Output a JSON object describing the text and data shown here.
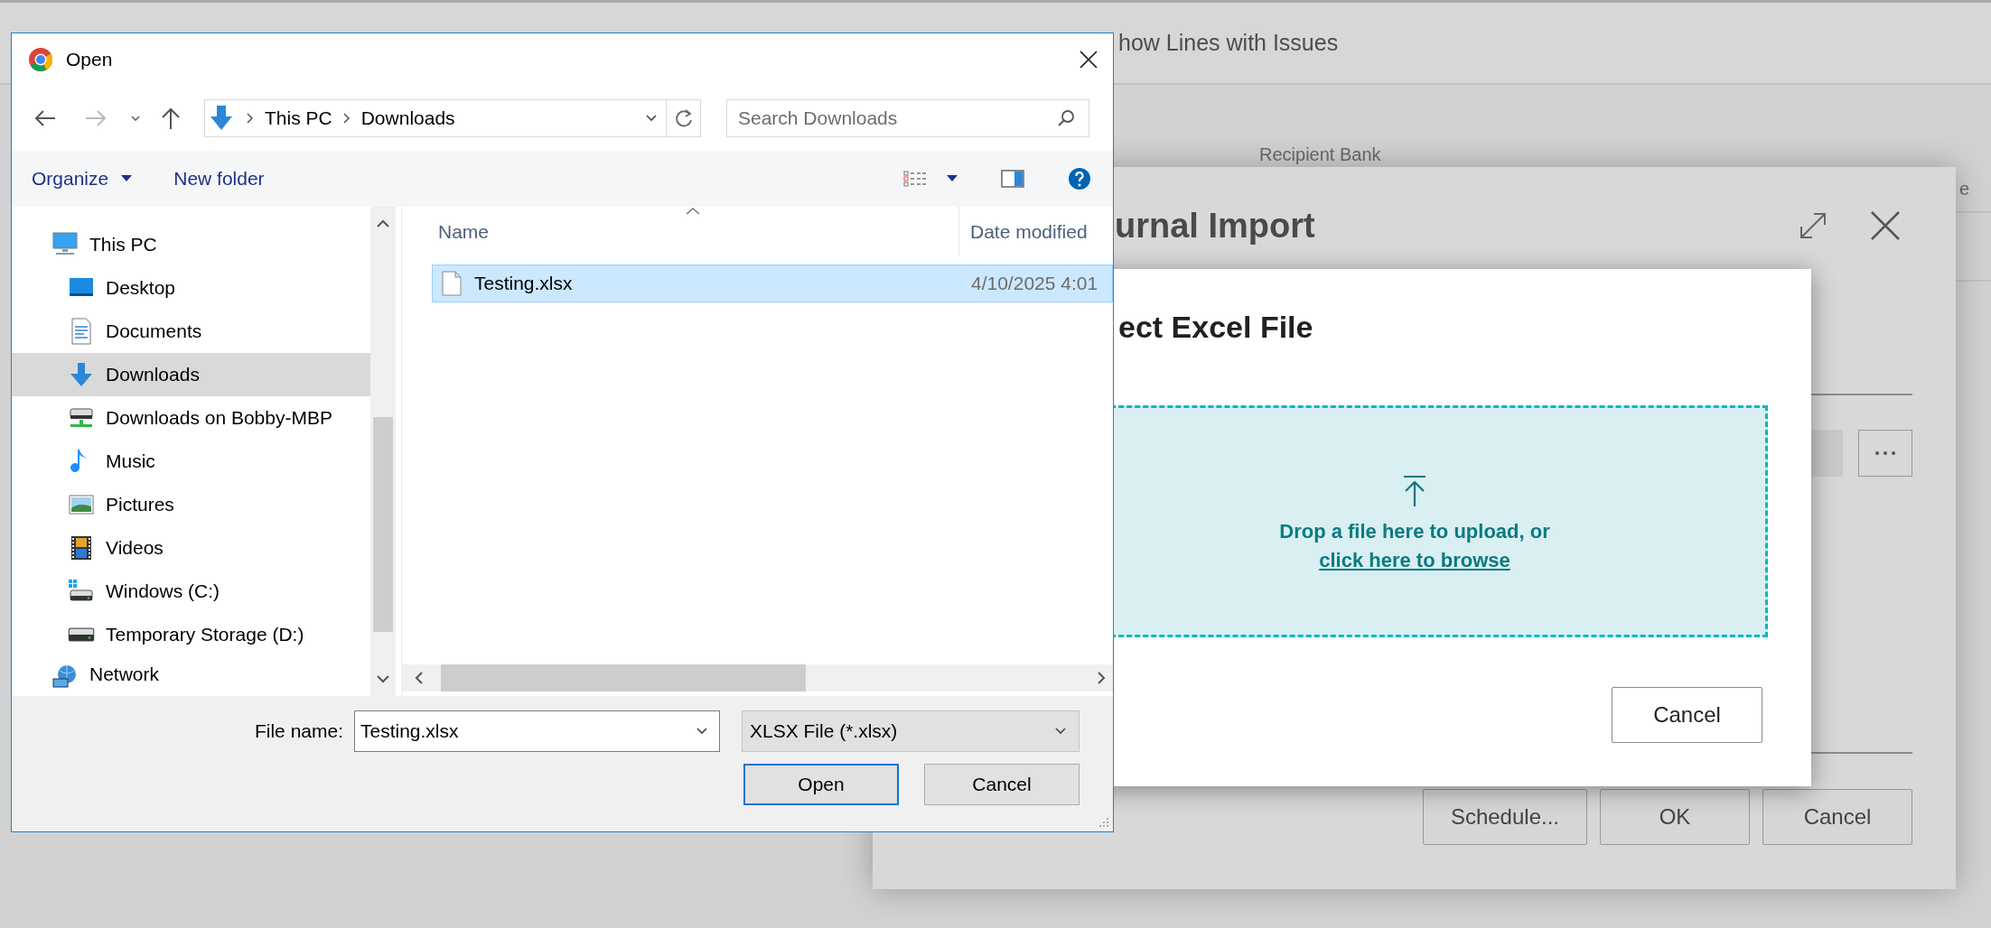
{
  "background": {
    "toolbar_action": "how Lines with Issues",
    "field_label": "Recipient Bank",
    "column_fragment": "e"
  },
  "journal_dialog": {
    "title": "urnal Import",
    "buttons": [
      "Schedule...",
      "OK",
      "Cancel"
    ]
  },
  "excel_dialog": {
    "title": "ect Excel File",
    "drop_text": "Drop a file here to upload, or",
    "browse_link": "click here to browse",
    "cancel": "Cancel"
  },
  "open_dialog": {
    "title": "Open",
    "breadcrumb": [
      "This PC",
      "Downloads"
    ],
    "search": {
      "placeholder": "Search Downloads"
    },
    "commands": [
      {
        "label": "Organize",
        "dropdown": true
      },
      {
        "label": "New folder",
        "dropdown": false
      }
    ],
    "nav_items": [
      {
        "label": "This PC",
        "kind": "computer",
        "selected": false,
        "children": [
          {
            "label": "Desktop",
            "kind": "desktop",
            "selected": false
          },
          {
            "label": "Documents",
            "kind": "documents",
            "selected": false
          },
          {
            "label": "Downloads",
            "kind": "downloads",
            "selected": true
          },
          {
            "label": "Downloads on Bobby-MBP",
            "kind": "share",
            "selected": false
          },
          {
            "label": "Music",
            "kind": "music",
            "selected": false
          },
          {
            "label": "Pictures",
            "kind": "pictures",
            "selected": false
          },
          {
            "label": "Videos",
            "kind": "videos",
            "selected": false
          },
          {
            "label": "Windows (C:)",
            "kind": "system",
            "selected": false
          },
          {
            "label": "Temporary Storage (D:)",
            "kind": "drive",
            "selected": false
          }
        ]
      },
      {
        "label": "Network",
        "kind": "network",
        "selected": false
      }
    ],
    "columns": [
      "Name",
      "Date modified"
    ],
    "files": [
      {
        "name": "Testing.xlsx",
        "date": "4/10/2025 4:01",
        "selected": true
      }
    ],
    "file_name_label": "File name:",
    "file_name": {
      "value": "Testing.xlsx"
    },
    "file_type": {
      "value": "XLSX File (*.xlsx)"
    },
    "buttons": [
      {
        "label": "Open",
        "default": true
      },
      {
        "label": "Cancel",
        "default": false
      }
    ]
  }
}
